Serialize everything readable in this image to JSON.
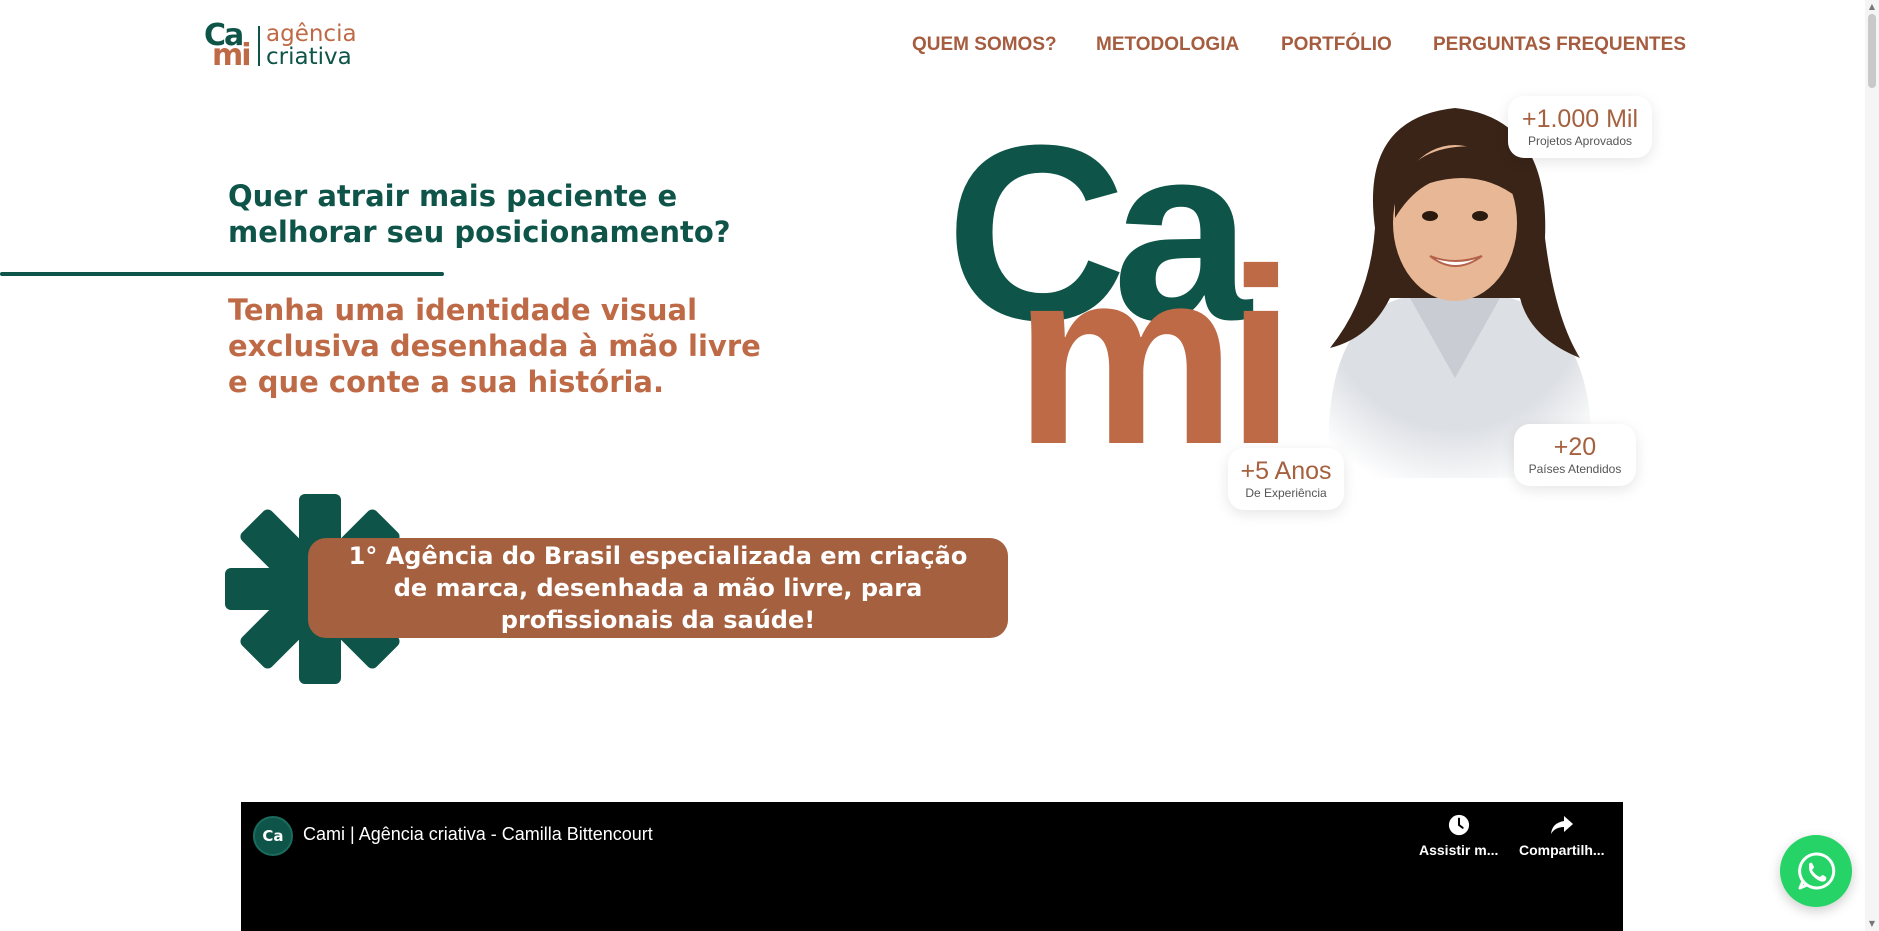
{
  "header": {
    "logo": {
      "mark_top": "Ca",
      "mark_bottom": "mi",
      "line1": "agência",
      "line2": "criativa"
    },
    "nav": [
      "QUEM SOMOS?",
      "METODOLOGIA",
      "PORTFÓLIO",
      "PERGUNTAS FREQUENTES"
    ]
  },
  "hero": {
    "question": "Quer atrair mais paciente e melhorar seu posicionamento?",
    "subtitle": "Tenha uma identidade visual exclusiva desenhada à mão livre e que conte a sua história.",
    "banner": "1° Agência do Brasil especializada em criação de marca, desenhada a mão livre, para profissionais da saúde!",
    "big_word": {
      "top": "Ca",
      "bottom": "mi"
    },
    "stats": [
      {
        "value": "+1.000 Mil",
        "label": "Projetos Aprovados"
      },
      {
        "value": "+20",
        "label": "Países Atendidos"
      },
      {
        "value": "+5 Anos",
        "label": "De Experiência"
      }
    ]
  },
  "video": {
    "channel_initials": "Ca",
    "title": "Cami | Agência criativa - Camilla Bittencourt",
    "watch_later": "Assistir m...",
    "share": "Compartilh..."
  },
  "icons": {
    "clock": "clock-icon",
    "share": "share-arrow-icon",
    "whatsapp": "whatsapp-icon",
    "asterisk": "asterisk-decoration"
  },
  "colors": {
    "green": "#0e5448",
    "terracotta": "#bf6a46",
    "banner": "#a5613f",
    "whatsapp": "#25d366"
  }
}
